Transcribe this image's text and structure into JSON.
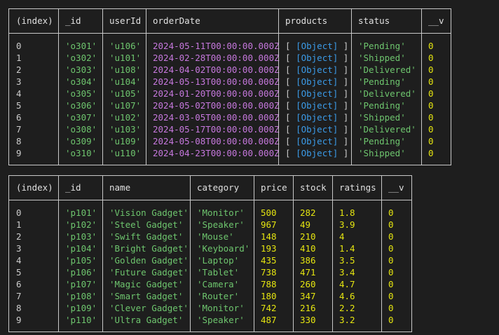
{
  "orders": {
    "columns": [
      "(index)",
      "_id",
      "userId",
      "orderDate",
      "products",
      "status",
      "__v"
    ],
    "rows": [
      {
        "index": "0",
        "_id": "'o301'",
        "userId": "'u106'",
        "orderDate": "2024-05-11T00:00:00.000Z",
        "products": "[Object]",
        "status": "'Pending'",
        "__v": "0"
      },
      {
        "index": "1",
        "_id": "'o302'",
        "userId": "'u101'",
        "orderDate": "2024-02-28T00:00:00.000Z",
        "products": "[Object]",
        "status": "'Shipped'",
        "__v": "0"
      },
      {
        "index": "2",
        "_id": "'o303'",
        "userId": "'u108'",
        "orderDate": "2024-04-02T00:00:00.000Z",
        "products": "[Object]",
        "status": "'Delivered'",
        "__v": "0"
      },
      {
        "index": "3",
        "_id": "'o304'",
        "userId": "'u104'",
        "orderDate": "2024-05-13T00:00:00.000Z",
        "products": "[Object]",
        "status": "'Pending'",
        "__v": "0"
      },
      {
        "index": "4",
        "_id": "'o305'",
        "userId": "'u105'",
        "orderDate": "2024-01-20T00:00:00.000Z",
        "products": "[Object]",
        "status": "'Delivered'",
        "__v": "0"
      },
      {
        "index": "5",
        "_id": "'o306'",
        "userId": "'u107'",
        "orderDate": "2024-05-02T00:00:00.000Z",
        "products": "[Object]",
        "status": "'Pending'",
        "__v": "0"
      },
      {
        "index": "6",
        "_id": "'o307'",
        "userId": "'u102'",
        "orderDate": "2024-03-05T00:00:00.000Z",
        "products": "[Object]",
        "status": "'Shipped'",
        "__v": "0"
      },
      {
        "index": "7",
        "_id": "'o308'",
        "userId": "'u103'",
        "orderDate": "2024-05-17T00:00:00.000Z",
        "products": "[Object]",
        "status": "'Delivered'",
        "__v": "0"
      },
      {
        "index": "8",
        "_id": "'o309'",
        "userId": "'u109'",
        "orderDate": "2024-05-08T00:00:00.000Z",
        "products": "[Object]",
        "status": "'Pending'",
        "__v": "0"
      },
      {
        "index": "9",
        "_id": "'o310'",
        "userId": "'u110'",
        "orderDate": "2024-04-23T00:00:00.000Z",
        "products": "[Object]",
        "status": "'Shipped'",
        "__v": "0"
      }
    ]
  },
  "products": {
    "columns": [
      "(index)",
      "_id",
      "name",
      "category",
      "price",
      "stock",
      "ratings",
      "__v"
    ],
    "rows": [
      {
        "index": "0",
        "_id": "'p101'",
        "name": "'Vision Gadget'",
        "category": "'Monitor'",
        "price": "500",
        "stock": "282",
        "ratings": "1.8",
        "__v": "0"
      },
      {
        "index": "1",
        "_id": "'p102'",
        "name": "'Steel Gadget'",
        "category": "'Speaker'",
        "price": "967",
        "stock": "49",
        "ratings": "3.9",
        "__v": "0"
      },
      {
        "index": "2",
        "_id": "'p103'",
        "name": "'Swift Gadget'",
        "category": "'Mouse'",
        "price": "148",
        "stock": "210",
        "ratings": "4",
        "__v": "0"
      },
      {
        "index": "3",
        "_id": "'p104'",
        "name": "'Bright Gadget'",
        "category": "'Keyboard'",
        "price": "193",
        "stock": "410",
        "ratings": "1.4",
        "__v": "0"
      },
      {
        "index": "4",
        "_id": "'p105'",
        "name": "'Golden Gadget'",
        "category": "'Laptop'",
        "price": "435",
        "stock": "386",
        "ratings": "3.5",
        "__v": "0"
      },
      {
        "index": "5",
        "_id": "'p106'",
        "name": "'Future Gadget'",
        "category": "'Tablet'",
        "price": "738",
        "stock": "471",
        "ratings": "3.4",
        "__v": "0"
      },
      {
        "index": "6",
        "_id": "'p107'",
        "name": "'Magic Gadget'",
        "category": "'Camera'",
        "price": "788",
        "stock": "260",
        "ratings": "4.7",
        "__v": "0"
      },
      {
        "index": "7",
        "_id": "'p108'",
        "name": "'Smart Gadget'",
        "category": "'Router'",
        "price": "180",
        "stock": "347",
        "ratings": "4.6",
        "__v": "0"
      },
      {
        "index": "8",
        "_id": "'p109'",
        "name": "'Clever Gadget'",
        "category": "'Monitor'",
        "price": "742",
        "stock": "216",
        "ratings": "2.2",
        "__v": "0"
      },
      {
        "index": "9",
        "_id": "'p110'",
        "name": "'Ultra Gadget'",
        "category": "'Speaker'",
        "price": "487",
        "stock": "330",
        "ratings": "3.2",
        "__v": "0"
      }
    ]
  },
  "colors": {
    "background": "#1e1e1e",
    "border": "#c8c8c8",
    "string": "#6ec56e",
    "number": "#e5e510",
    "date": "#c678dd",
    "object": "#3b9be8",
    "text": "#cccccc"
  }
}
